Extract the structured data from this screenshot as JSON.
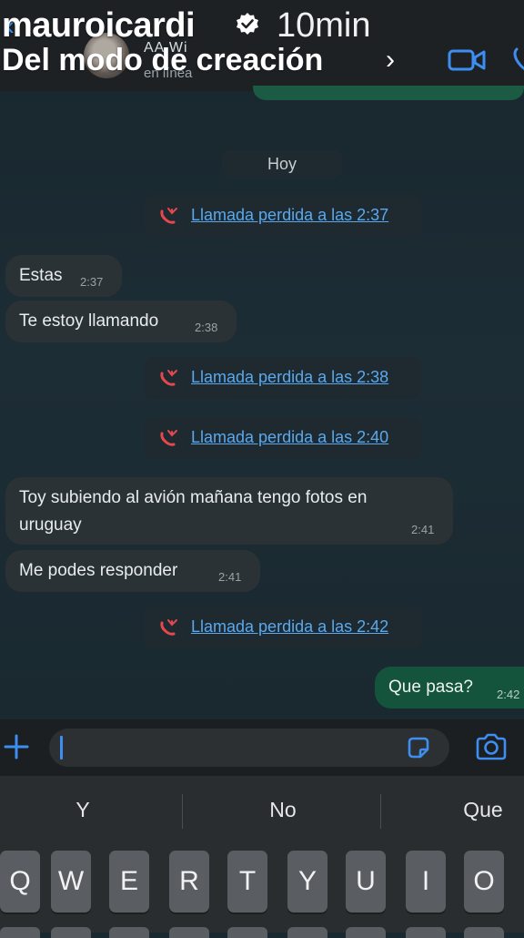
{
  "story": {
    "username": "mauroicardi",
    "time_ago": "10min",
    "subtitle": "Del modo de creación",
    "subtitle_chevron": "›"
  },
  "chat_header": {
    "back_icon": "chevron-left-icon",
    "contact_name": "AA Wi",
    "contact_status": "en línea",
    "video_call_icon": "video-camera-icon",
    "voice_call_icon": "phone-icon"
  },
  "date_separator": "Hoy",
  "messages": [
    {
      "kind": "missed_call",
      "text": "Llamada perdida a las 2:37"
    },
    {
      "kind": "incoming",
      "text": "Estas",
      "time": "2:37"
    },
    {
      "kind": "incoming",
      "text": "Te estoy llamando",
      "time": "2:38"
    },
    {
      "kind": "missed_call",
      "text": "Llamada perdida a las 2:38"
    },
    {
      "kind": "missed_call",
      "text": "Llamada perdida a las 2:40"
    },
    {
      "kind": "incoming",
      "text": "Toy subiendo al avión mañana tengo fotos en",
      "text2": "uruguay",
      "time": "2:41"
    },
    {
      "kind": "incoming",
      "text": "Me podes responder",
      "time": "2:41"
    },
    {
      "kind": "missed_call",
      "text": "Llamada perdida a las 2:42"
    },
    {
      "kind": "outgoing",
      "text": "Que pasa?",
      "time": "2:42"
    }
  ],
  "input_bar": {
    "attach_icon": "plus-icon",
    "message_value": "",
    "sticker_icon": "sticker-icon",
    "camera_icon": "camera-icon"
  },
  "keyboard": {
    "suggestions": [
      "Y",
      "No",
      "Que"
    ],
    "top_row": [
      "Q",
      "W",
      "E",
      "R",
      "T",
      "Y",
      "U",
      "I",
      "O"
    ]
  },
  "colors": {
    "accent_blue": "#3d8ef0",
    "missed_call_red": "#e5484d",
    "link_blue": "#5aa8ee",
    "outgoing_bubble": "#14533c",
    "incoming_bubble": "#2b3236"
  }
}
